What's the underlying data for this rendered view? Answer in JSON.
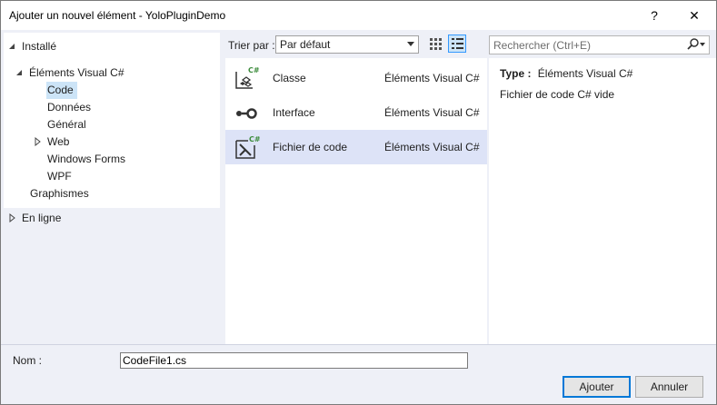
{
  "window": {
    "title": "Ajouter un nouvel élément - YoloPluginDemo",
    "help_glyph": "?",
    "close_glyph": "✕"
  },
  "tree": {
    "installed": "Installé",
    "visual_cs": "Éléments Visual C#",
    "children": [
      "Code",
      "Données",
      "Général",
      "Web",
      "Windows Forms",
      "WPF"
    ],
    "graphics": "Graphismes",
    "online": "En ligne",
    "selected": "Code"
  },
  "toolbar": {
    "sort_label": "Trier par :",
    "sort_value": "Par défaut",
    "search_placeholder": "Rechercher (Ctrl+E)"
  },
  "templates": [
    {
      "name": "Classe",
      "category": "Éléments Visual C#",
      "icon": "class-icon"
    },
    {
      "name": "Interface",
      "category": "Éléments Visual C#",
      "icon": "interface-icon"
    },
    {
      "name": "Fichier de code",
      "category": "Éléments Visual C#",
      "icon": "code-file-icon"
    }
  ],
  "selected_template": "Fichier de code",
  "details": {
    "type_label": "Type :",
    "type_value": "Éléments Visual C#",
    "description": "Fichier de code C# vide"
  },
  "footer": {
    "name_label": "Nom :",
    "name_value": "CodeFile1.cs",
    "ok_label": "Ajouter",
    "cancel_label": "Annuler"
  },
  "colors": {
    "selection": "#cce4f7",
    "row_selected": "#dde3f7",
    "panel_bg": "#eef0f7",
    "accent": "#0078d7"
  }
}
